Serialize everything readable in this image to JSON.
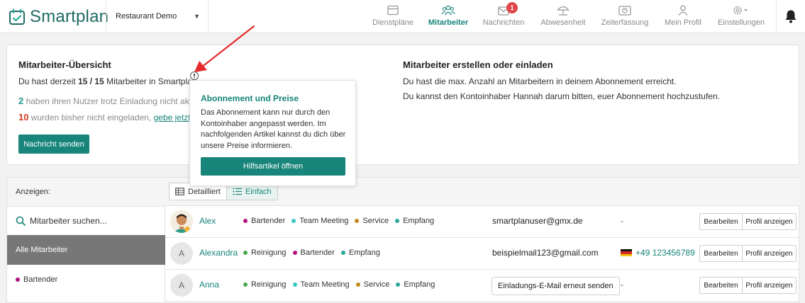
{
  "app": {
    "logo_text": "Smartplan",
    "company": "Restaurant Demo"
  },
  "nav": [
    {
      "label": "Dienstpläne",
      "icon": "calendar-icon",
      "active": false
    },
    {
      "label": "Mitarbeiter",
      "icon": "team-icon",
      "active": true
    },
    {
      "label": "Nachrichten",
      "icon": "mail-icon",
      "active": false,
      "badge": "1"
    },
    {
      "label": "Abwesenheit",
      "icon": "umbrella-icon",
      "active": false
    },
    {
      "label": "Zeiterfassung",
      "icon": "timeclock-icon",
      "active": false
    },
    {
      "label": "Mein Profil",
      "icon": "user-icon",
      "active": false
    },
    {
      "label": "Einstellungen",
      "icon": "gear-icon",
      "active": false
    }
  ],
  "overview": {
    "title": "Mitarbeiter-Übersicht",
    "count_prefix": "Du hast derzeit ",
    "count_value": "15 / 15",
    "count_suffix": " Mitarbeiter in Smartplan.",
    "pending_count": "2",
    "pending_text": " haben ihren Nutzer trotz Einladung nicht aktivi",
    "uninvited_count": "10",
    "uninvited_text": " wurden bisher nicht eingeladen, ",
    "uninvited_link": "gebe jetzt ih",
    "send_button": "Nachricht senden",
    "right_title": "Mitarbeiter erstellen oder einladen",
    "right_line1": "Du hast die max. Anzahl an Mitarbeitern in deinem Abonnement erreicht.",
    "right_line2": "Du kannst den Kontoinhaber Hannah darum bitten, euer Abonnement hochzustufen."
  },
  "popover": {
    "title": "Abonnement und Preise",
    "body": "Das Abonnement kann nur durch den Kontoinhaber angepasst werden. Im nachfolgenden Artikel kannst du dich über unsere Preise informieren.",
    "button": "Hilfsartikel öffnen"
  },
  "list": {
    "show_label": "Anzeigen:",
    "search_placeholder": "Mitarbeiter suchen...",
    "all_label": "Alle Mitarbeiter",
    "filter_bartender": "Bartender",
    "view_detailed": "Detailliert",
    "view_simple": "Einfach",
    "edit_label": "Bearbeiten",
    "profile_label": "Profil anzeigen",
    "invite_label": "Einladungs-E-Mail erneut senden",
    "dash": "-"
  },
  "colors": {
    "brand": "#17857a",
    "bartender": "#b0127f",
    "teammeeting": "#38c7c2",
    "service": "#c28a1a",
    "empfang": "#2aa79b",
    "reinigung": "#4aa84a"
  },
  "employees": [
    {
      "name": "Alex",
      "initial": "",
      "photo": true,
      "tags": [
        {
          "label": "Bartender",
          "color": "#b0127f"
        },
        {
          "label": "Team Meeting",
          "color": "#38c7c2"
        },
        {
          "label": "Service",
          "color": "#c28a1a"
        },
        {
          "label": "Empfang",
          "color": "#2aa79b"
        }
      ],
      "email": "smartplanuser@gmx.de",
      "phone": ""
    },
    {
      "name": "Alexandra",
      "initial": "A",
      "photo": false,
      "tags": [
        {
          "label": "Reinigung",
          "color": "#4aa84a"
        },
        {
          "label": "Bartender",
          "color": "#b0127f"
        },
        {
          "label": "Empfang",
          "color": "#2aa79b"
        }
      ],
      "email": "beispielmail123@gmail.com",
      "phone": "+49 123456789"
    },
    {
      "name": "Anna",
      "initial": "A",
      "photo": false,
      "tags": [
        {
          "label": "Reinigung",
          "color": "#4aa84a"
        },
        {
          "label": "Team Meeting",
          "color": "#38c7c2"
        },
        {
          "label": "Service",
          "color": "#c28a1a"
        },
        {
          "label": "Empfang",
          "color": "#2aa79b"
        }
      ],
      "email": "",
      "phone": "",
      "invite": true
    }
  ]
}
